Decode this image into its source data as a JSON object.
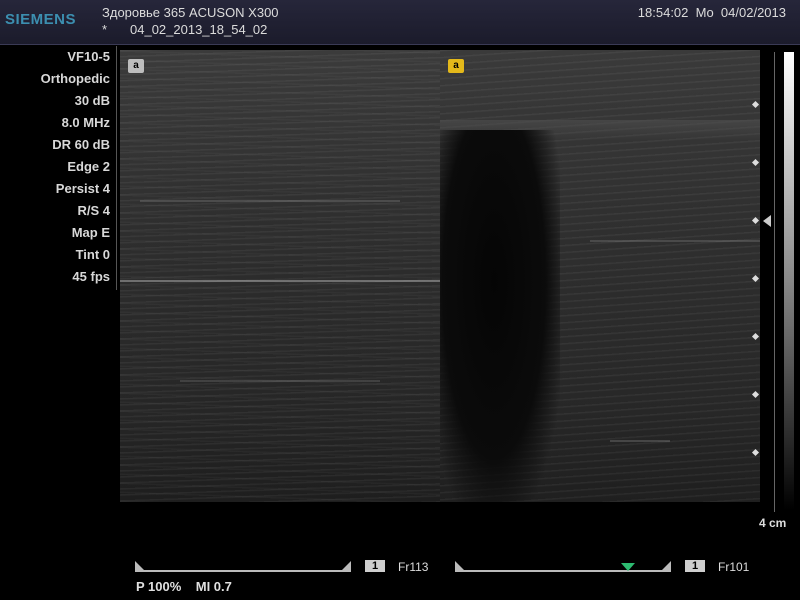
{
  "header": {
    "brand": "SIEMENS",
    "title": "Здоровье 365 ACUSON X300",
    "star": "*",
    "exam_id": "04_02_2013_18_54_02",
    "time": "18:54:02",
    "day": "Mo",
    "date": "04/02/2013"
  },
  "sidebar": {
    "params": [
      "VF10-5",
      "Orthopedic",
      "30 dB",
      "8.0 MHz",
      "DR 60 dB",
      "Edge 2",
      "Persist 4",
      "R/S 4",
      "Map E",
      "Tint 0",
      "45 fps"
    ]
  },
  "markers": {
    "left": "a",
    "right": "a"
  },
  "depth": {
    "label": "4 cm"
  },
  "cine": {
    "left": {
      "box": "1",
      "frame": "Fr113"
    },
    "right": {
      "box": "1",
      "frame": "Fr101"
    }
  },
  "footer": {
    "power": "P 100%",
    "mi": "MI 0.7"
  },
  "colors": {
    "brand": "#3c8fb0",
    "marker_yellow": "#e3b81a",
    "cine_indicator": "#2dbb71"
  }
}
